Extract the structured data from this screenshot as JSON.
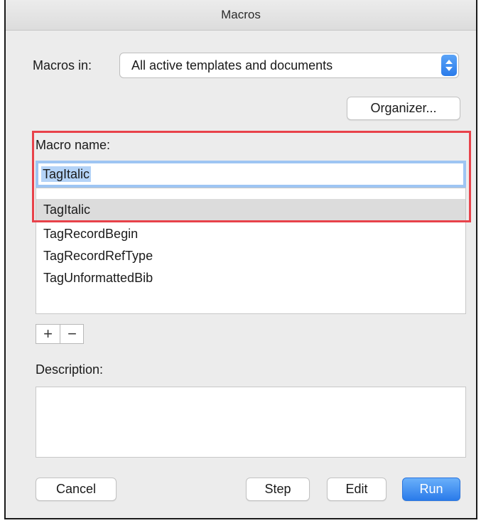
{
  "window": {
    "title": "Macros"
  },
  "macros_in": {
    "label": "Macros in:",
    "selected": "All active templates and documents"
  },
  "organizer_label": "Organizer...",
  "macro_name": {
    "label": "Macro name:",
    "value": "TagItalic"
  },
  "macro_list": {
    "items": [
      "TagItalic",
      "TagRecordBegin",
      "TagRecordRefType",
      "TagUnformattedBib"
    ],
    "selected_index": 0
  },
  "list_controls": {
    "add": "+",
    "remove": "−"
  },
  "description": {
    "label": "Description:",
    "value": ""
  },
  "buttons": {
    "cancel": "Cancel",
    "step": "Step",
    "edit": "Edit",
    "run": "Run"
  },
  "colors": {
    "accent": "#2a7bea",
    "highlight": "#e8424a",
    "selection": "#b4d3f7"
  }
}
